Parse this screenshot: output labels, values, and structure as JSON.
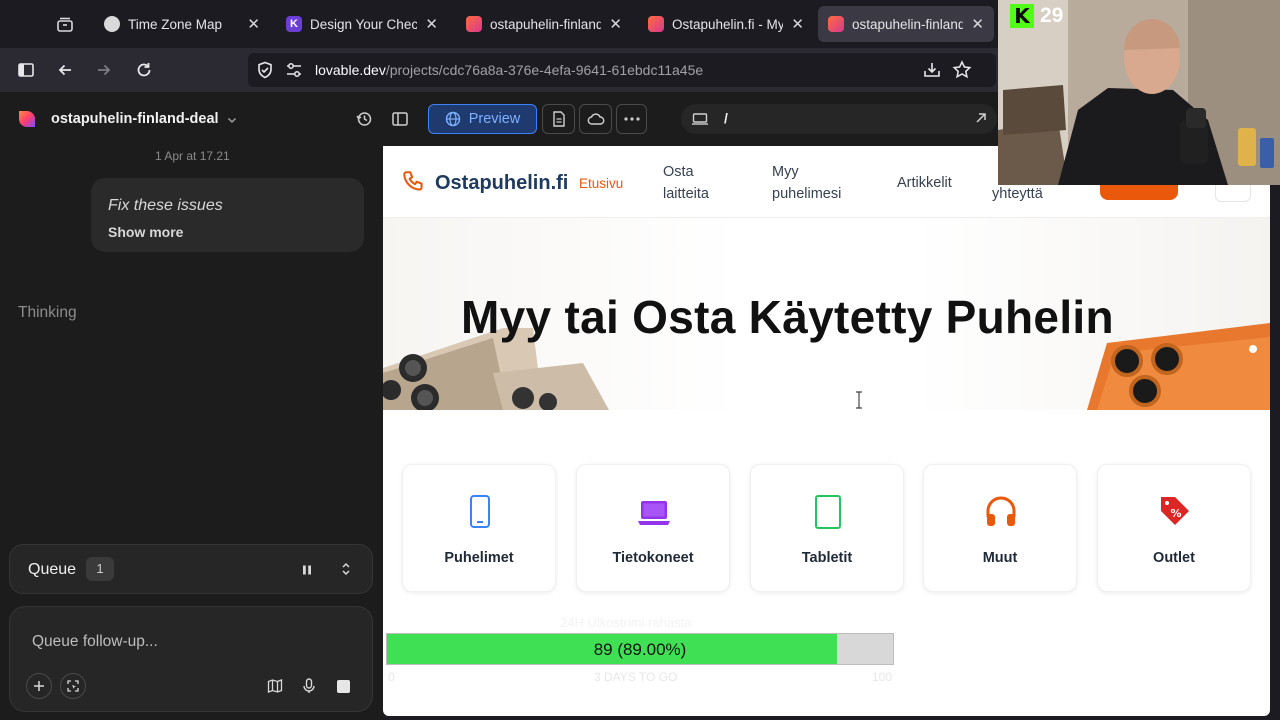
{
  "browser": {
    "tabs": [
      {
        "title": "Time Zone Map",
        "fav_color": "#d9d9d9"
      },
      {
        "title": "Design Your Checklis",
        "fav_color": "#6b3fd6"
      },
      {
        "title": "ostapuhelin-finland-",
        "fav_color": "#e0456b"
      },
      {
        "title": "Ostapuhelin.fi - Myy",
        "fav_color": "#e0456b"
      },
      {
        "title": "ostapuhelin-finland-",
        "fav_color": "#e0456b"
      }
    ],
    "url_host": "lovable.dev",
    "url_path": "/projects/cdc76a8a-376e-4efa-9641-61ebdc11a45e"
  },
  "app": {
    "project_name": "ostapuhelin-finland-deal",
    "preview_label": "Preview",
    "route": "/"
  },
  "chat": {
    "timestamp": "1 Apr at 17.21",
    "message": "Fix these issues",
    "show_more": "Show more",
    "thinking": "Thinking",
    "queue_label": "Queue",
    "queue_count": "1",
    "followup_placeholder": "Queue follow-up..."
  },
  "site": {
    "logo": "Ostapuhelin.fi",
    "nav": {
      "home": "Etusivu",
      "buy": "Osta laitteita",
      "sell": "Myy puhelimesi",
      "articles": "Artikkelit",
      "contact_partial": "yhteyttä"
    },
    "hero_title": "Myy tai Osta Käytetty Puhelin",
    "categories": [
      {
        "label": "Puhelimet",
        "icon": "phone-icon",
        "color": "#3b82f6"
      },
      {
        "label": "Tietokoneet",
        "icon": "laptop-icon",
        "color": "#9333ea"
      },
      {
        "label": "Tabletit",
        "icon": "tablet-icon",
        "color": "#22c55e"
      },
      {
        "label": "Muut",
        "icon": "headphones-icon",
        "color": "#ea580c"
      },
      {
        "label": "Outlet",
        "icon": "tag-icon",
        "color": "#dc2626"
      }
    ]
  },
  "overlay": {
    "goal_caption": "24H Ulkostrimi rahasta",
    "progress_text": "89 (89.00%)",
    "progress_value": 89,
    "progress_max": 100,
    "left_label": "0",
    "days_label": "3 DAYS TO GO",
    "right_label": "100",
    "kick_count": "29",
    "progress_color": "#3fe054"
  }
}
